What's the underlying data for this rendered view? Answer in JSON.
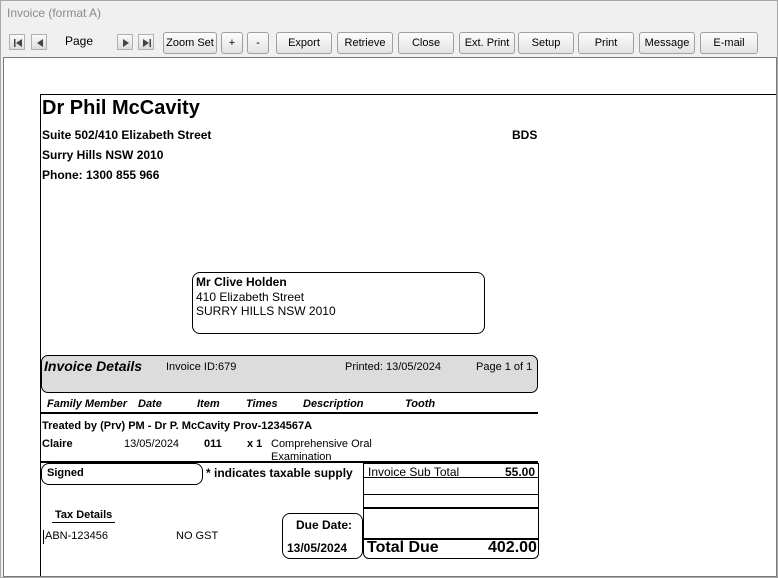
{
  "window": {
    "title": "Invoice (format A)"
  },
  "toolbar": {
    "page_label": "Page",
    "zoom_set": "Zoom Set",
    "zoom_in": "+",
    "zoom_out": "-",
    "export": "Export",
    "retrieve": "Retrieve",
    "close": "Close",
    "ext_print": "Ext. Print",
    "setup": "Setup",
    "print": "Print",
    "message": "Message",
    "email": "E-mail"
  },
  "practice": {
    "name": "Dr Phil McCavity",
    "address1": "Suite 502/410 Elizabeth Street",
    "address2": "Surry Hills NSW 2010",
    "phone": "Phone: 1300 855 966",
    "qualification": "BDS"
  },
  "recipient": {
    "name": "Mr Clive  Holden",
    "line1": "410 Elizabeth Street",
    "line2": "SURRY HILLS NSW 2010"
  },
  "invoice_header": {
    "title": "Invoice Details",
    "invoice_id": "Invoice ID:679",
    "printed": "Printed: 13/05/2024",
    "page": "Page 1 of 1"
  },
  "columns": {
    "family_member": "Family Member",
    "date": "Date",
    "item": "Item",
    "times": "Times",
    "description": "Description",
    "tooth": "Tooth"
  },
  "treated_by": "Treated by (Prv) PM - Dr P. McCavity Prov-1234567A",
  "line_item": {
    "member": "Claire",
    "date": "13/05/2024",
    "item": "011",
    "times": "x  1",
    "description_line1": "Comprehensive Oral",
    "description_line2": "Examination"
  },
  "footer": {
    "signed": "Signed",
    "taxable_note": "* indicates taxable supply",
    "subtotal_label": "Invoice Sub Total",
    "subtotal_value": "55.00",
    "tax_details": "Tax Details",
    "abn": "ABN-123456",
    "gst": "NO GST",
    "due_date_label": "Due Date:",
    "due_date_value": "13/05/2024",
    "total_due_label": "Total Due",
    "total_due_value": "402.00"
  }
}
